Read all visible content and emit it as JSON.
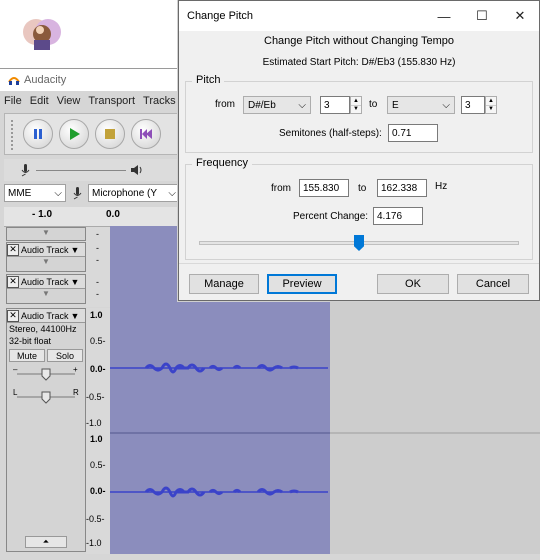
{
  "audacity": {
    "app_title": "Audacity",
    "menu": [
      "File",
      "Edit",
      "View",
      "Transport",
      "Tracks"
    ],
    "device": {
      "host": "MME",
      "mic": "Microphone (Y"
    },
    "ruler": {
      "left": "- 1.0",
      "right": "0.0"
    },
    "tracks": [
      {
        "name": "Audio Track"
      },
      {
        "name": "Audio Track"
      },
      {
        "name": "Audio Track",
        "info1": "Stereo, 44100Hz",
        "info2": "32-bit float",
        "mute": "Mute",
        "solo": "Solo"
      }
    ],
    "scale_labels": [
      "1.0",
      "0.5-",
      "0.0-",
      "-0.5-",
      "-1.0"
    ],
    "waveform_color": "#3b43c9",
    "selected_region_color": "#8b8dbd"
  },
  "dialog": {
    "title": "Change Pitch",
    "heading": "Change Pitch without Changing Tempo",
    "estimated": "Estimated Start Pitch: D#/Eb3 (155.830 Hz)",
    "pitch": {
      "group_label": "Pitch",
      "from_label": "from",
      "from_note": "D#/Eb",
      "from_octave": "3",
      "to_label": "to",
      "to_note": "E",
      "to_octave": "3",
      "semitones_label": "Semitones (half-steps):",
      "semitones_value": "0.71"
    },
    "frequency": {
      "group_label": "Frequency",
      "from_label": "from",
      "from_value": "155.830",
      "to_label": "to",
      "to_value": "162.338",
      "unit": "Hz",
      "percent_label": "Percent Change:",
      "percent_value": "4.176",
      "slider_percent": 50
    },
    "buttons": {
      "manage": "Manage",
      "preview": "Preview",
      "ok": "OK",
      "cancel": "Cancel"
    },
    "accent_color": "#0078d7"
  }
}
